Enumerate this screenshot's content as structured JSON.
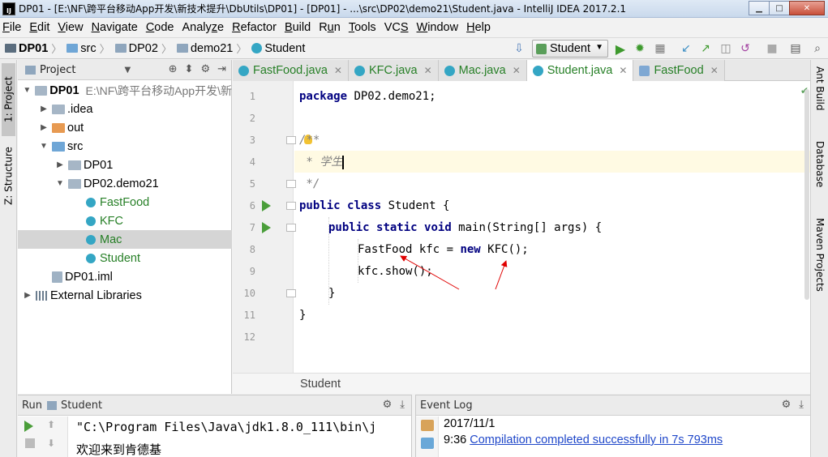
{
  "window": {
    "title": "DP01 - [E:\\NF\\跨平台移动App开发\\新技术提升\\DbUtils\\DP01] - [DP01] - ...\\src\\DP02\\demo21\\Student.java - IntelliJ IDEA 2017.2.1",
    "app_icon": "IJ"
  },
  "menu": [
    {
      "ul": "F",
      "rest": "ile"
    },
    {
      "ul": "E",
      "rest": "dit"
    },
    {
      "ul": "V",
      "rest": "iew"
    },
    {
      "ul": "N",
      "rest": "avigate"
    },
    {
      "ul": "C",
      "rest": "ode"
    },
    {
      "ul": "",
      "rest": "Analy",
      "ul2": "z",
      "rest2": "e"
    },
    {
      "ul": "R",
      "rest": "efactor"
    },
    {
      "ul": "B",
      "rest": "uild"
    },
    {
      "ul": "",
      "rest": "R",
      "ul2": "u",
      "rest2": "n"
    },
    {
      "ul": "T",
      "rest": "ools"
    },
    {
      "ul": "",
      "rest": "VC",
      "ul2": "S",
      "rest2": ""
    },
    {
      "ul": "W",
      "rest": "indow"
    },
    {
      "ul": "H",
      "rest": "elp"
    }
  ],
  "breadcrumbs": [
    "DP01",
    "src",
    "DP02",
    "demo21",
    "Student"
  ],
  "run_config": "Student",
  "left_stripe": {
    "project_tab": "1: Project",
    "structure_tab": "Z: Structure"
  },
  "right_stripe": {
    "ant": "Ant Build",
    "db": "Database",
    "maven": "Maven Projects"
  },
  "project_panel": {
    "title": "Project",
    "tree": [
      {
        "label": "DP01",
        "path": "E:\\NF\\跨平台移动App开发\\新",
        "icon": "folder",
        "twisty": "▼",
        "indent": 0,
        "bold": true
      },
      {
        "label": ".idea",
        "icon": "folder",
        "twisty": "▶",
        "indent": 1
      },
      {
        "label": "out",
        "icon": "orange",
        "twisty": "▶",
        "indent": 1
      },
      {
        "label": "src",
        "icon": "blue",
        "twisty": "▼",
        "indent": 1
      },
      {
        "label": "DP01",
        "icon": "pkg",
        "twisty": "▶",
        "indent": 2
      },
      {
        "label": "DP02.demo21",
        "icon": "pkg",
        "twisty": "▼",
        "indent": 2
      },
      {
        "label": "FastFood",
        "icon": "cls",
        "twisty": "",
        "indent": 3,
        "green": true
      },
      {
        "label": "KFC",
        "icon": "cls",
        "twisty": "",
        "indent": 3,
        "green": true
      },
      {
        "label": "Mac",
        "icon": "cls",
        "twisty": "",
        "indent": 3,
        "green": true,
        "selected": true
      },
      {
        "label": "Student",
        "icon": "cls",
        "twisty": "",
        "indent": 3,
        "green": true
      },
      {
        "label": "DP01.iml",
        "icon": "iml",
        "twisty": "",
        "indent": 1
      },
      {
        "label": "External Libraries",
        "icon": "lib",
        "twisty": "▶",
        "indent": 0
      }
    ]
  },
  "editor": {
    "tabs": [
      {
        "label": "FastFood.java",
        "icon": "cls",
        "active": false
      },
      {
        "label": "KFC.java",
        "icon": "cls",
        "active": false
      },
      {
        "label": "Mac.java",
        "icon": "cls",
        "active": false
      },
      {
        "label": "Student.java",
        "icon": "cls",
        "active": true
      },
      {
        "label": "FastFood",
        "icon": "ifc",
        "active": false
      }
    ],
    "lines": [
      "1",
      "2",
      "3",
      "4",
      "5",
      "6",
      "7",
      "8",
      "9",
      "10",
      "11",
      "12"
    ],
    "code": {
      "l1_kw": "package",
      "l1_rest": " DP02.demo21;",
      "l3": "/**",
      "l4": " * 学生",
      "l5": " */",
      "l6_kw1": "public",
      "l6_kw2": "class",
      "l6_rest": " Student {",
      "l7_kw1": "public",
      "l7_kw2": "static",
      "l7_kw3": "void",
      "l7_rest": " main(String[] args) {",
      "l8_a": "FastFood kfc = ",
      "l8_kw": "new",
      "l8_b": " KFC();",
      "l9": "kfc.show();",
      "l10": "}",
      "l11": "}"
    },
    "breadcrumb": "Student"
  },
  "run_panel": {
    "title_prefix": "Run",
    "title": "Student",
    "output": [
      "\"C:\\Program Files\\Java\\jdk1.8.0_111\\bin\\j",
      "欢迎来到肯德基"
    ]
  },
  "event_log": {
    "title": "Event Log",
    "date": "2017/11/1",
    "time": "9:36",
    "message": "Compilation completed successfully in 7s 793ms"
  },
  "colors": {
    "keyword": "#000080",
    "comment": "#808080",
    "class_green": "#267f26",
    "link": "#1f47c9",
    "annotation": "#e00000"
  }
}
